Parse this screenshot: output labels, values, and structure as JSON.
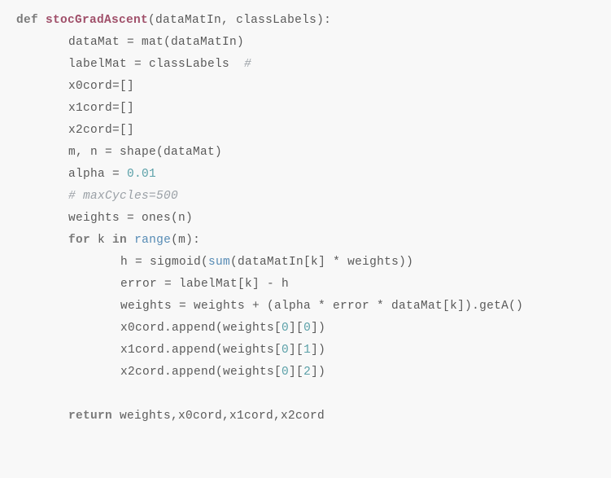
{
  "code": {
    "lines": [
      {
        "indent": 0,
        "tokens": [
          {
            "t": "def ",
            "c": "kw"
          },
          {
            "t": "stocGradAscent",
            "c": "fname"
          },
          {
            "t": "(dataMatIn, classLabels):",
            "c": ""
          }
        ]
      },
      {
        "indent": 1,
        "tokens": [
          {
            "t": "dataMat = mat(dataMatIn)",
            "c": ""
          }
        ]
      },
      {
        "indent": 1,
        "tokens": [
          {
            "t": "labelMat = classLabels  ",
            "c": ""
          },
          {
            "t": "#",
            "c": "comment"
          }
        ]
      },
      {
        "indent": 1,
        "tokens": [
          {
            "t": "x0cord=[]",
            "c": ""
          }
        ]
      },
      {
        "indent": 1,
        "tokens": [
          {
            "t": "x1cord=[]",
            "c": ""
          }
        ]
      },
      {
        "indent": 1,
        "tokens": [
          {
            "t": "x2cord=[]",
            "c": ""
          }
        ]
      },
      {
        "indent": 1,
        "tokens": [
          {
            "t": "m, n = shape(dataMat)",
            "c": ""
          }
        ]
      },
      {
        "indent": 1,
        "tokens": [
          {
            "t": "alpha = ",
            "c": ""
          },
          {
            "t": "0.01",
            "c": "num"
          }
        ]
      },
      {
        "indent": 1,
        "tokens": [
          {
            "t": "# maxCycles=500",
            "c": "comment"
          }
        ]
      },
      {
        "indent": 1,
        "tokens": [
          {
            "t": "weights = ones(n)",
            "c": ""
          }
        ]
      },
      {
        "indent": 1,
        "tokens": [
          {
            "t": "for",
            "c": "kw"
          },
          {
            "t": " k ",
            "c": ""
          },
          {
            "t": "in",
            "c": "kw"
          },
          {
            "t": " ",
            "c": ""
          },
          {
            "t": "range",
            "c": "builtin"
          },
          {
            "t": "(m):",
            "c": ""
          }
        ]
      },
      {
        "indent": 2,
        "tokens": [
          {
            "t": "h = sigmoid(",
            "c": ""
          },
          {
            "t": "sum",
            "c": "builtin"
          },
          {
            "t": "(dataMatIn[k] * weights))",
            "c": ""
          }
        ]
      },
      {
        "indent": 2,
        "tokens": [
          {
            "t": "error = labelMat[k] - h",
            "c": ""
          }
        ]
      },
      {
        "indent": 2,
        "tokens": [
          {
            "t": "weights = weights + (alpha * error * dataMat[k]).getA()",
            "c": ""
          }
        ]
      },
      {
        "indent": 2,
        "tokens": [
          {
            "t": "x0cord.append(weights[",
            "c": ""
          },
          {
            "t": "0",
            "c": "num"
          },
          {
            "t": "][",
            "c": ""
          },
          {
            "t": "0",
            "c": "num"
          },
          {
            "t": "])",
            "c": ""
          }
        ]
      },
      {
        "indent": 2,
        "tokens": [
          {
            "t": "x1cord.append(weights[",
            "c": ""
          },
          {
            "t": "0",
            "c": "num"
          },
          {
            "t": "][",
            "c": ""
          },
          {
            "t": "1",
            "c": "num"
          },
          {
            "t": "])",
            "c": ""
          }
        ]
      },
      {
        "indent": 2,
        "tokens": [
          {
            "t": "x2cord.append(weights[",
            "c": ""
          },
          {
            "t": "0",
            "c": "num"
          },
          {
            "t": "][",
            "c": ""
          },
          {
            "t": "2",
            "c": "num"
          },
          {
            "t": "])",
            "c": ""
          }
        ]
      },
      {
        "indent": 0,
        "tokens": [
          {
            "t": "",
            "c": ""
          }
        ]
      },
      {
        "indent": 1,
        "tokens": [
          {
            "t": "return",
            "c": "kw"
          },
          {
            "t": " weights,x0cord,x1cord,x2cord",
            "c": ""
          }
        ]
      }
    ]
  }
}
